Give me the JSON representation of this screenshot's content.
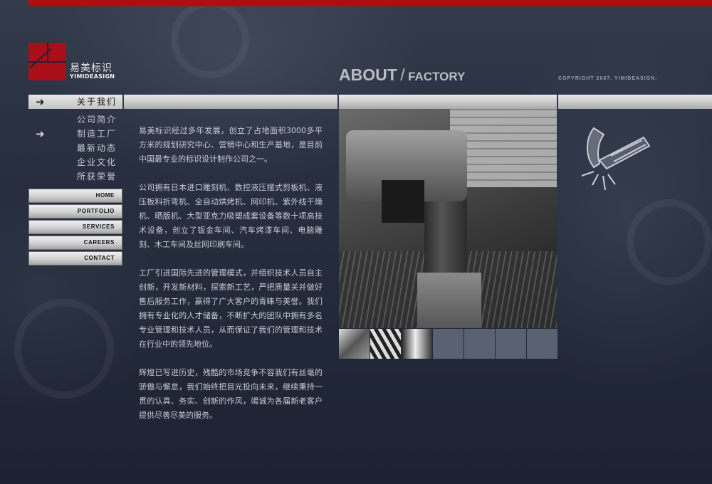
{
  "brand": {
    "name_cn": "易美标识",
    "name_en": "YIMIDEASIGN"
  },
  "page_heading": {
    "main": "ABOUT",
    "separator": "/",
    "sub": "FACTORY"
  },
  "copyright": "COPYRIGHT 2007. YIMIDEASIGN.",
  "section_nav": {
    "active_label": "关于我们",
    "items": [
      {
        "label": "公司简介",
        "active": false
      },
      {
        "label": "制造工厂",
        "active": true
      },
      {
        "label": "最新动态",
        "active": false
      },
      {
        "label": "企业文化",
        "active": false
      },
      {
        "label": "所获荣誉",
        "active": false
      }
    ]
  },
  "main_nav": [
    "HOME",
    "PORTFOLIO",
    "SERVICES",
    "CAREERS",
    "CONTACT"
  ],
  "content": {
    "paragraphs": [
      "易美标识经过多年发展，创立了占地面积3000多平方米的规划研究中心、营销中心和生产基地，是目前中国最专业的标识设计制作公司之一。",
      "公司拥有日本进口雕刻机、数控液压摆式剪板机、液压板料折弯机、全自动烘烤机、网印机、紫外线干燥机、晒版机、大型亚克力吸塑成套设备等数十项高技术设备，创立了钣金车间、汽车烤漆车间、电脑雕刻、木工车间及丝网印刷车间。",
      "工厂引进国际先进的管理模式，并组织技术人员自主创新，开发新材料，探索新工艺，严把质量关并做好售后服务工作，赢得了广大客户的青睐与美誉。我们拥有专业化的人才储备，不断扩大的团队中拥有多名专业管理和技术人员，从而保证了我们的管理和技术在行业中的领先地位。",
      "辉煌已写进历史，残酷的市场竞争不容我们有丝毫的骄傲与懈怠，我们始终把目光投向未来，继续秉持一贯的认真、务实、创新的作风，竭诚为各届新老客户提供尽善尽美的服务。"
    ]
  },
  "gallery": {
    "thumbnails": [
      {
        "filled": true
      },
      {
        "filled": true
      },
      {
        "filled": true
      },
      {
        "filled": false
      },
      {
        "filled": false
      },
      {
        "filled": false
      },
      {
        "filled": false
      }
    ]
  },
  "colors": {
    "accent_red": "#b20c12",
    "background": "#1e2535",
    "text": "#c6cbd6"
  },
  "icons": [
    "arrow-right-icon",
    "hammer-icon"
  ]
}
